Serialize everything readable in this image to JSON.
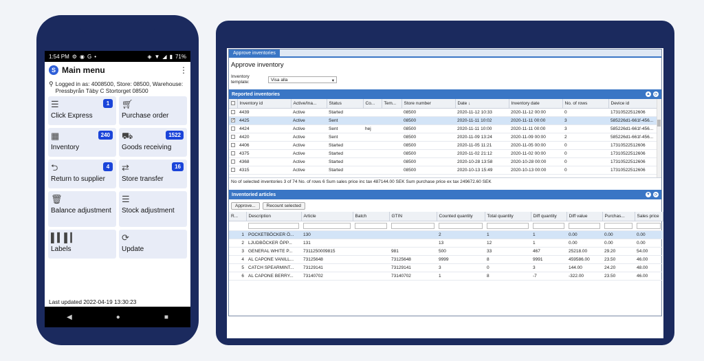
{
  "phone": {
    "status": {
      "time": "1:54 PM",
      "battery": "71%"
    },
    "app_title": "Main menu",
    "login_info": "Logged in as: 4008500, Store: 08500, Warehouse: Pressbyrån Täby C Stortorget 08500",
    "tiles": [
      {
        "label": "Click Express",
        "badge": "1",
        "icon": "list-icon"
      },
      {
        "label": "Purchase order",
        "badge": "",
        "icon": "cart-icon"
      },
      {
        "label": "Inventory",
        "badge": "240",
        "icon": "calculator-icon"
      },
      {
        "label": "Goods receiving",
        "badge": "1522",
        "icon": "truck-icon"
      },
      {
        "label": "Return to supplier",
        "badge": "4",
        "icon": "arrow-left-circle-icon"
      },
      {
        "label": "Store transfer",
        "badge": "16",
        "icon": "swap-icon"
      },
      {
        "label": "Balance adjustment",
        "badge": "",
        "icon": "trash-icon"
      },
      {
        "label": "Stock adjustment",
        "badge": "",
        "icon": "list-icon"
      },
      {
        "label": "Labels",
        "badge": "",
        "icon": "barcode-icon"
      },
      {
        "label": "Update",
        "badge": "",
        "icon": "refresh-icon"
      }
    ],
    "last_updated": "Last updated 2022-04-19 13:30:23"
  },
  "desktop": {
    "tab": "Approve inventories",
    "title": "Approve inventory",
    "template_label": "Inventory template:",
    "template_value": "Visa alla",
    "reported": {
      "header": "Reported inventories",
      "columns": [
        "Inventory id",
        "Active/Ina...",
        "Status",
        "Co...",
        "Tem...",
        "Store number",
        "Date ↓",
        "Inventory date",
        "No. of rows",
        "Device id"
      ],
      "rows": [
        [
          "4439",
          "Active",
          "Started",
          "",
          "",
          "08500",
          "2020-11-12 10:33",
          "2020-11-12 00:00",
          "0",
          "17310522512606"
        ],
        [
          "4425",
          "Active",
          "Sent",
          "",
          "",
          "08500",
          "2020-11-11 10:02",
          "2020-11-11 00:00",
          "3",
          "585226d1-661f-456..."
        ],
        [
          "4424",
          "Active",
          "Sent",
          "hej",
          "",
          "08500",
          "2020-11-11 10:00",
          "2020-11-11 00:00",
          "3",
          "585226d1-661f-456..."
        ],
        [
          "4420",
          "Active",
          "Sent",
          "",
          "",
          "08500",
          "2020-11-09 13:24",
          "2020-11-09 00:00",
          "2",
          "585226d1-661f-456..."
        ],
        [
          "4406",
          "Active",
          "Started",
          "",
          "",
          "08500",
          "2020-11-05 11:21",
          "2020-11-05 00:00",
          "0",
          "17310522512606"
        ],
        [
          "4375",
          "Active",
          "Started",
          "",
          "",
          "08500",
          "2020-11-02 21:12",
          "2020-11-02 00:00",
          "0",
          "17310522512606"
        ],
        [
          "4368",
          "Active",
          "Started",
          "",
          "",
          "08500",
          "2020-10-28 13:58",
          "2020-10-28 00:00",
          "0",
          "17310522512606"
        ],
        [
          "4315",
          "Active",
          "Started",
          "",
          "",
          "08500",
          "2020-10-13 15:49",
          "2020-10-13 00:00",
          "0",
          "17310522512606"
        ]
      ],
      "selected_row": 1,
      "summary": "No of selected inventories   3 of 74   No. of rows   6   Sum sales price inc tax   487144.00   SEK   Sum purchase price ex tax   249672.60   SEK"
    },
    "articles": {
      "header": "Inventoried articles",
      "approve_btn": "Approve...",
      "recount_btn": "Recount selected",
      "columns": [
        "R...",
        "Description",
        "Article",
        "Batch",
        "GTIN",
        "Counted quantity",
        "Total quantity",
        "Diff quantity",
        "Diff value",
        "Purchas...",
        "Sales price"
      ],
      "rows": [
        [
          "1",
          "POCKETBÖCKER Ö...",
          "130",
          "",
          "",
          "2",
          "1",
          "1",
          "0.00",
          "0.00",
          "0.00"
        ],
        [
          "2",
          "LJUDBÖCKER ÖPP...",
          "131",
          "",
          "",
          "13",
          "12",
          "1",
          "0.00",
          "0.00",
          "0.00"
        ],
        [
          "3",
          "GENERAL WHITE P...",
          "7311250009815",
          "",
          "981",
          "500",
          "33",
          "467",
          "25218.00",
          "29.20",
          "54.00"
        ],
        [
          "4",
          "AL CAPONE VANILL...",
          "73125648",
          "",
          "73125648",
          "9999",
          "8",
          "9991",
          "459586.00",
          "23.50",
          "46.00"
        ],
        [
          "5",
          "CATCH SPEARMINT...",
          "73129141",
          "",
          "73129141",
          "3",
          "0",
          "3",
          "144.00",
          "24.20",
          "48.00"
        ],
        [
          "6",
          "AL CAPONE BERRY...",
          "73140702",
          "",
          "73140702",
          "1",
          "8",
          "-7",
          "-322.00",
          "23.50",
          "46.00"
        ]
      ],
      "selected_row": 0
    }
  },
  "colors": {
    "navy": "#1b2a5e",
    "accent": "#3a76c5",
    "badge": "#1a44d9",
    "tile": "#e8ecf7",
    "selection": "#d3e4f7"
  }
}
